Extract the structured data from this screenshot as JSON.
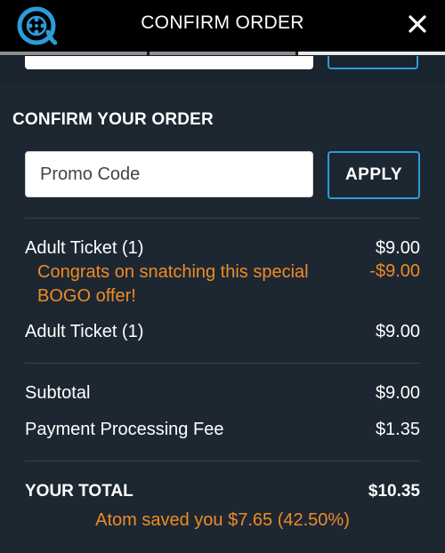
{
  "header": {
    "title": "CONFIRM ORDER",
    "logo_icon": "atom-logo-icon",
    "close_icon": "close-icon"
  },
  "section": {
    "title": "CONFIRM YOUR ORDER"
  },
  "promo": {
    "placeholder": "Promo Code",
    "value": "",
    "apply_label": "APPLY"
  },
  "line_items": [
    {
      "label": "Adult Ticket (1)",
      "amount": "$9.00"
    },
    {
      "label": "Adult Ticket (1)",
      "amount": "$9.00"
    }
  ],
  "discount": {
    "message": "Congrats on snatching this special BOGO offer!",
    "amount": "-$9.00"
  },
  "summary": {
    "subtotal_label": "Subtotal",
    "subtotal_amount": "$9.00",
    "fee_label": "Payment Processing Fee",
    "fee_amount": "$1.35"
  },
  "total": {
    "label": "YOUR TOTAL",
    "amount": "$10.35",
    "savings_text": "Atom saved you $7.65 (42.50%)"
  },
  "colors": {
    "accent_blue": "#2a9dd8",
    "highlight_orange": "#f08a24",
    "panel_bg": "#1c2732",
    "header_bg": "#000000"
  }
}
